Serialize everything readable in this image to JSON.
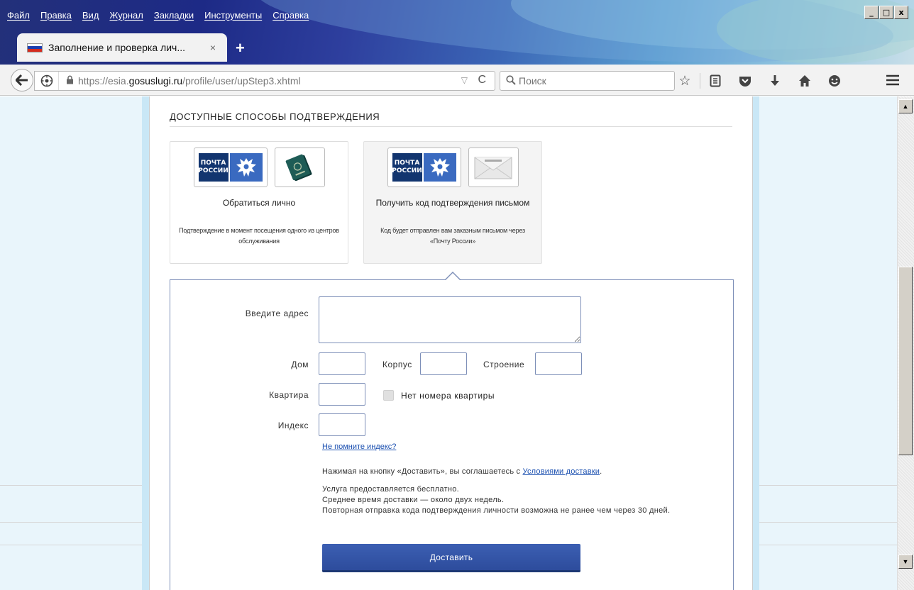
{
  "browser": {
    "menu": [
      "Файл",
      "Правка",
      "Вид",
      "Журнал",
      "Закладки",
      "Инструменты",
      "Справка"
    ],
    "window_controls": [
      "_",
      "□",
      "x"
    ],
    "tab": {
      "title": "Заполнение и проверка лич...",
      "close": "×"
    },
    "new_tab": "+",
    "url": {
      "prefix": "https://esia.",
      "host": "gosuslugi.ru",
      "path": "/profile/user/upStep3.xhtml"
    },
    "search": {
      "placeholder": "Поиск"
    },
    "icons": [
      "bookmark-star-icon",
      "reading-list-icon",
      "pocket-icon",
      "download-icon",
      "home-icon",
      "hello-chat-icon"
    ]
  },
  "page": {
    "section_title": "ДОСТУПНЫЕ СПОСОБЫ ПОДТВЕРЖДЕНИЯ",
    "methods": [
      {
        "logo_text": [
          "ПОЧТА",
          "РОССИИ"
        ],
        "title": "Обратиться лично",
        "description": "Подтверждение в момент посещения одного из центров обслуживания"
      },
      {
        "logo_text": [
          "ПОЧТА",
          "РОССИИ"
        ],
        "title": "Получить код подтверждения письмом",
        "description": "Код будет отправлен вам заказным письмом через «Почту России»",
        "selected": true
      }
    ],
    "form": {
      "address_label": "Введите адрес",
      "house_label": "Дом",
      "building_label": "Корпус",
      "structure_label": "Строение",
      "apartment_label": "Квартира",
      "no_apartment_label": "Нет номера квартиры",
      "postcode_label": "Индекс",
      "forgot_postcode": "Не помните индекс?",
      "agree_prefix": "Нажимая на кнопку «Доставить», вы соглашаетесь с ",
      "agree_link": "Условиями доставки",
      "agree_suffix": ".",
      "info_1": "Услуга предоставляется бесплатно.",
      "info_2": "Среднее время доставки — около двух недель.",
      "info_3": "Повторная отправка кода подтверждения личности возможна не ранее чем через 30 дней.",
      "submit": "Доставить"
    }
  },
  "colors": {
    "accent": "#2d4c9c",
    "link": "#1a4fb0",
    "field_border": "#7d8fb8",
    "page_background": "#c9e7f6"
  }
}
